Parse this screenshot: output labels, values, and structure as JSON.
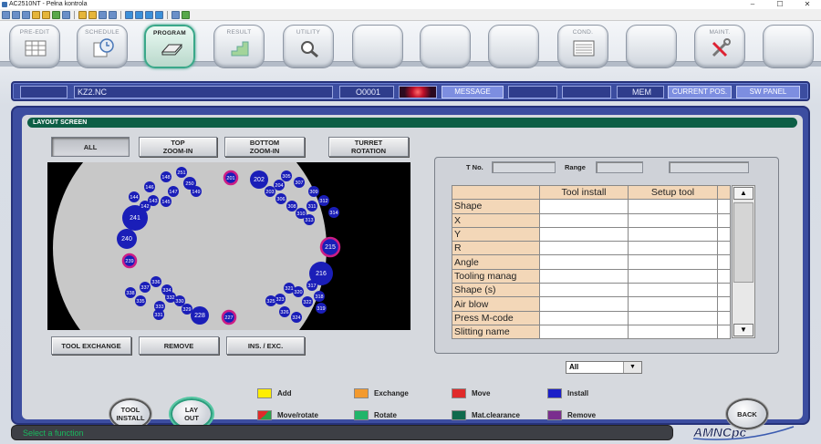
{
  "window": {
    "title": "AC2510NT - Pełna kontrola",
    "minimize": "–",
    "maximize": "☐",
    "close": "✕"
  },
  "tabs": [
    {
      "label": "PRE-EDIT",
      "icon": "grid-icon"
    },
    {
      "label": "SCHEDULE",
      "icon": "clock-document-icon"
    },
    {
      "label": "PROGRAM",
      "icon": "sheet-tray-icon",
      "active": true
    },
    {
      "label": "RESULT",
      "icon": "steps-icon"
    },
    {
      "label": "UTILITY",
      "icon": "magnifier-icon"
    },
    {
      "label": "",
      "icon": ""
    },
    {
      "label": "",
      "icon": ""
    },
    {
      "label": "",
      "icon": ""
    },
    {
      "label": "COND.",
      "icon": "panel-icon"
    },
    {
      "label": "",
      "icon": ""
    },
    {
      "label": "MAINT.",
      "icon": "tools-icon"
    },
    {
      "label": "",
      "icon": ""
    }
  ],
  "status": {
    "program_name": "KZ2.NC",
    "program_number": "O0001",
    "message": "MESSAGE",
    "mode": "MEM",
    "current_pos": "CURRENT POS.",
    "sw_panel": "SW PANEL"
  },
  "screen": {
    "title": "LAYOUT SCREEN",
    "view_buttons": [
      {
        "label": "ALL",
        "selected": true
      },
      {
        "label": "TOP\nZOOM-IN"
      },
      {
        "label": "BOTTOM\nZOOM-IN"
      },
      {
        "label": "TURRET\nROTATION"
      }
    ],
    "action_buttons": [
      "TOOL EXCHANGE",
      "REMOVE",
      "INS. / EXC."
    ],
    "tno_label": "T No.",
    "range_label": "Range",
    "filter_value": "All"
  },
  "turret": {
    "stations": [
      {
        "id": "201",
        "color": "#cc1d86",
        "ring": true
      },
      {
        "id": "202"
      },
      {
        "id": "203"
      },
      {
        "id": "204"
      },
      {
        "id": "305"
      },
      {
        "id": "306"
      },
      {
        "id": "307"
      },
      {
        "id": "308"
      },
      {
        "id": "309"
      },
      {
        "id": "310"
      },
      {
        "id": "311"
      },
      {
        "id": "312"
      },
      {
        "id": "313"
      },
      {
        "id": "314"
      },
      {
        "id": "215",
        "color": "#cc1d86",
        "ring": true
      },
      {
        "id": "216"
      },
      {
        "id": "317"
      },
      {
        "id": "318"
      },
      {
        "id": "319"
      },
      {
        "id": "320"
      },
      {
        "id": "321"
      },
      {
        "id": "322"
      },
      {
        "id": "323"
      },
      {
        "id": "324"
      },
      {
        "id": "325"
      },
      {
        "id": "326"
      },
      {
        "id": "227",
        "color": "#cc1d86",
        "ring": true
      },
      {
        "id": "228"
      },
      {
        "id": "329"
      },
      {
        "id": "330"
      },
      {
        "id": "331"
      },
      {
        "id": "332"
      },
      {
        "id": "333"
      },
      {
        "id": "334"
      },
      {
        "id": "335"
      },
      {
        "id": "336"
      },
      {
        "id": "337"
      },
      {
        "id": "338"
      },
      {
        "id": "239",
        "color": "#cc1d86",
        "ring": true
      },
      {
        "id": "240"
      },
      {
        "id": "241"
      },
      {
        "id": "142"
      },
      {
        "id": "143"
      },
      {
        "id": "144"
      },
      {
        "id": "145"
      },
      {
        "id": "146"
      },
      {
        "id": "147"
      },
      {
        "id": "148"
      },
      {
        "id": "149"
      },
      {
        "id": "250"
      },
      {
        "id": "251"
      }
    ]
  },
  "tool_table": {
    "headers": [
      "",
      "Tool install",
      "Setup tool",
      ""
    ],
    "rows": [
      "Shape",
      "X",
      "Y",
      "R",
      "Angle",
      "Tooling manag",
      "Shape (s)",
      "Air blow",
      "Press M-code",
      "Slitting name"
    ]
  },
  "round_buttons": {
    "tool_install": "TOOL\nINSTALL",
    "layout": "LAY\nOUT",
    "back": "BACK"
  },
  "legend": [
    {
      "label": "Add",
      "color": "#ffee00"
    },
    {
      "label": "Exchange",
      "color": "#f39a2e"
    },
    {
      "label": "Move",
      "color": "#e02a2a"
    },
    {
      "label": "Install",
      "color": "#1b1fc8"
    },
    {
      "label": "Move/rotate",
      "color": "#2aa04a",
      "color2": "#e02a2a"
    },
    {
      "label": "Rotate",
      "color": "#20b56a"
    },
    {
      "label": "Mat.clearance",
      "color": "#0f6a4c"
    },
    {
      "label": "Remove",
      "color": "#7a2e8e"
    }
  ],
  "footer": {
    "message": "Select a function"
  },
  "logo": "AMNCpc"
}
